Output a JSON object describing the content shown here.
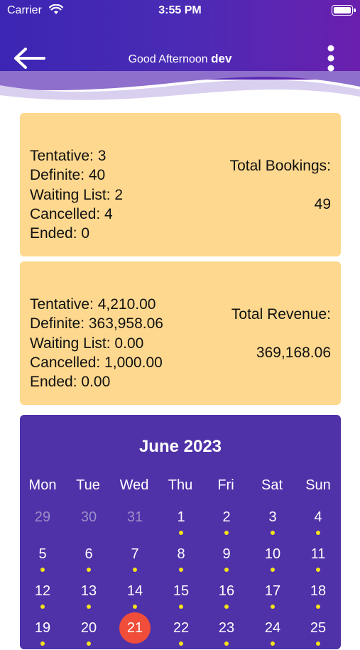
{
  "status_bar": {
    "carrier": "Carrier",
    "time": "3:55 PM"
  },
  "header": {
    "greeting": "Good Afternoon",
    "user": "dev",
    "back_icon": "arrow-left-icon",
    "menu_icon": "more-vertical-icon"
  },
  "bookings": {
    "lines": [
      "Tentative: 3",
      "Definite: 40",
      "Waiting List: 2",
      "Cancelled: 4",
      "Ended: 0"
    ],
    "total_label": "Total Bookings:",
    "total_value": "49"
  },
  "revenue": {
    "lines": [
      "Tentative: 4,210.00",
      "Definite: 363,958.06",
      "Waiting List: 0.00",
      "Cancelled: 1,000.00",
      "Ended: 0.00"
    ],
    "total_label": "Total Revenue:",
    "total_value": "369,168.06"
  },
  "calendar": {
    "title": "June 2023",
    "weekdays": [
      "Mon",
      "Tue",
      "Wed",
      "Thu",
      "Fri",
      "Sat",
      "Sun"
    ],
    "weeks": [
      [
        "29",
        "30",
        "31",
        "1",
        "2",
        "3",
        "4"
      ],
      [
        "5",
        "6",
        "7",
        "8",
        "9",
        "10",
        "11"
      ],
      [
        "12",
        "13",
        "14",
        "15",
        "16",
        "17",
        "18"
      ],
      [
        "19",
        "20",
        "21",
        "22",
        "23",
        "24",
        "25"
      ]
    ],
    "today": "21",
    "colors": {
      "background": "#4f31a8",
      "event_dot": "#f4e21a",
      "today": "#f04d3a"
    }
  },
  "colors": {
    "card": "#fed88e",
    "header_start": "#3c25b3",
    "header_end": "#6a1fae"
  }
}
